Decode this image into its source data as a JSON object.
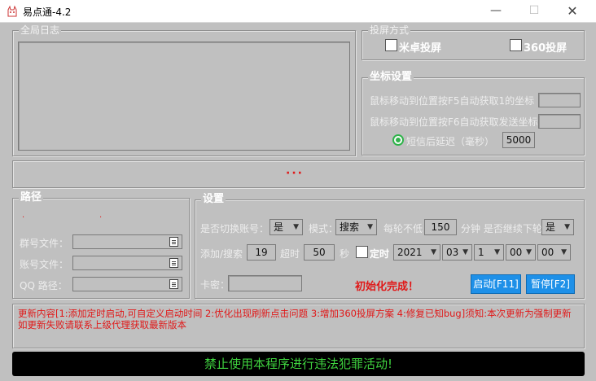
{
  "window": {
    "title": "易点通-4.2",
    "min": "—",
    "max": "☐",
    "close": "✕"
  },
  "log": {
    "legend": "全局日志"
  },
  "cast": {
    "legend": "投屏方式",
    "android": "米卓投屏",
    "p360": "360投屏"
  },
  "coords": {
    "legend": "坐标设置",
    "label1": "鼠标移动到位置按F5自动获取1的坐标",
    "label2": "鼠标移动到位置按F6自动获取发送坐标",
    "delay_label": "短信后延迟（毫秒）",
    "delay_value": "5000"
  },
  "status": {
    "dots": "···"
  },
  "path": {
    "legend": "路径",
    "mark1": "·",
    "mark2": "·",
    "group_file": "群号文件：",
    "account_file": "账号文件：",
    "qq_path": "QQ  路径："
  },
  "settings": {
    "legend": "设置",
    "switch_label": "是否切换账号：",
    "switch_value": "是",
    "mode_label": "模式：",
    "mode_value": "搜索",
    "per_round_label": "每轮不低",
    "per_round_value": "150",
    "minute_label": "分钟 是否继续下轮",
    "continue_value": "是",
    "add_search_label": "添加/搜索",
    "add_search_value": "19",
    "timeout_label": "超时",
    "timeout_value": "50",
    "sec_label": "秒",
    "timer_label": "定时",
    "year": "2021",
    "month": "03",
    "day": "1",
    "hour": "00",
    "minute": "00",
    "card_label": "卡密：",
    "init_status": "初始化完成！",
    "start_button": "启动[F11]",
    "pause_button": "暂停[F2]"
  },
  "notice": "更新内容[1:添加定时启动,可自定义启动时间  2:优化出现刷新点击问题  3:增加360投屏方案  4:修复已知bug]须知:本次更新为强制更新 如更新失败请联系上级代理获取最新版本",
  "footer": "禁止使用本程序进行违法犯罪活动!",
  "colors": {
    "accent": "#1e90e8",
    "warning": "#e01818",
    "footer_text": "#3fd33f"
  }
}
